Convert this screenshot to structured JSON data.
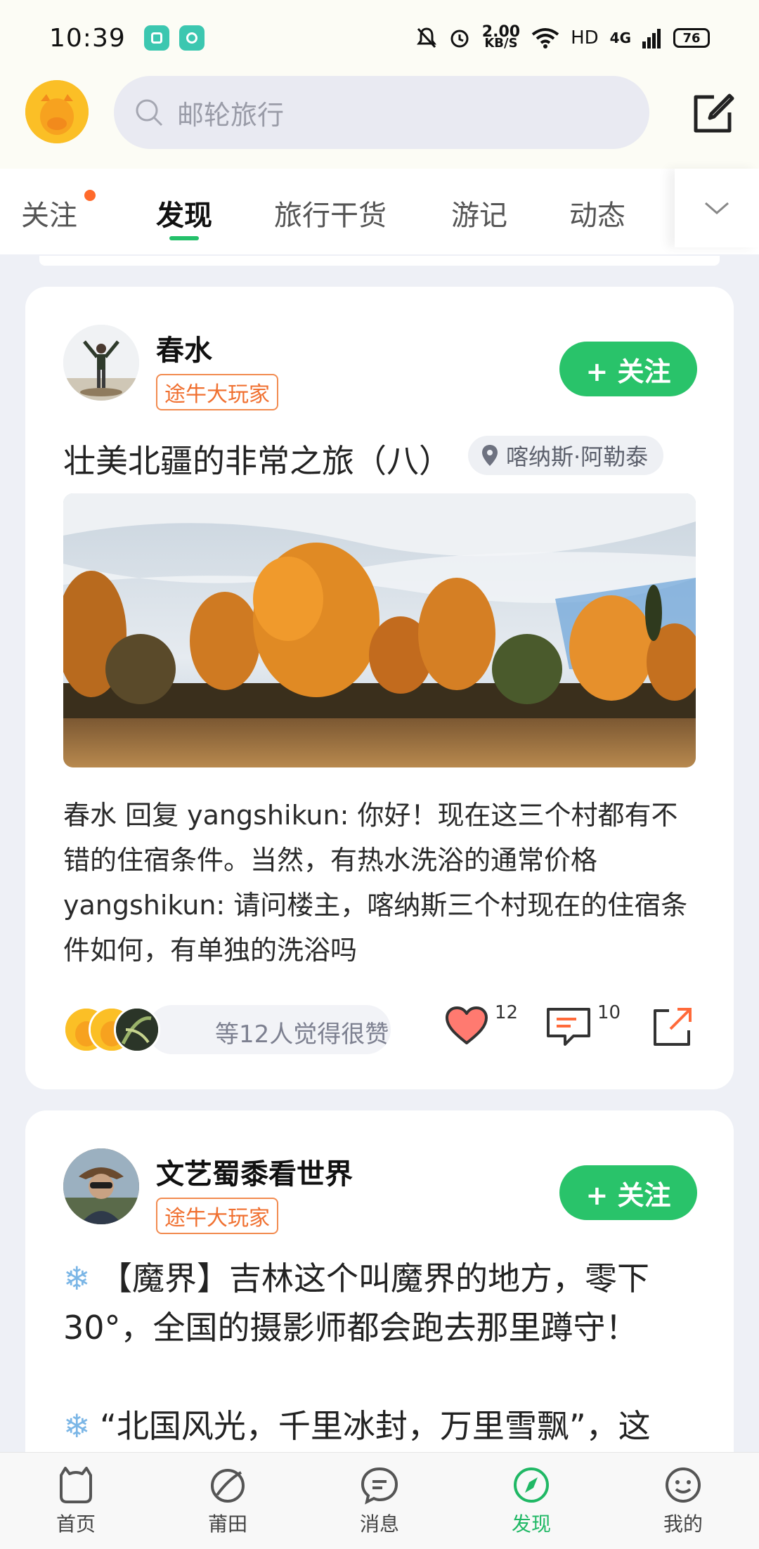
{
  "status_bar": {
    "time": "10:39",
    "speed_value": "2.00",
    "speed_unit": "KB/S",
    "hd": "HD",
    "network": "4G",
    "battery": "76"
  },
  "header": {
    "search_placeholder": "邮轮旅行"
  },
  "tabs": [
    {
      "label": "关注",
      "has_dot": true
    },
    {
      "label": "发现",
      "active": true
    },
    {
      "label": "旅行干货"
    },
    {
      "label": "游记"
    },
    {
      "label": "动态"
    }
  ],
  "posts": [
    {
      "author": "春水",
      "badge": "途牛大玩家",
      "follow_label": "+ 关注",
      "title": "壮美北疆的非常之旅（八）",
      "location": "喀纳斯·阿勒泰",
      "body": "春水 回复 yangshikun: 你好！现在这三个村都有不错的住宿条件。当然，有热水洗浴的通常价格 yangshikun: 请问楼主，喀纳斯三个村现在的住宿条件如何，有单独的洗浴吗",
      "likers_text": "等12人觉得很赞",
      "likes": "12",
      "comments": "10"
    },
    {
      "author": "文艺蜀黍看世界",
      "badge": "途牛大玩家",
      "follow_label": "+ 关注",
      "line1": "【魔界】吉林这个叫魔界的地方，零下30°，全国的摄影师都会跑去那里蹲守！",
      "line2": "“北国风光，千里冰封，万里雪飘”，这"
    }
  ],
  "bottom_nav": [
    {
      "label": "首页",
      "icon": "home-icon"
    },
    {
      "label": "莆田",
      "icon": "city-icon"
    },
    {
      "label": "消息",
      "icon": "message-icon"
    },
    {
      "label": "发现",
      "icon": "compass-icon",
      "active": true
    },
    {
      "label": "我的",
      "icon": "profile-icon"
    }
  ],
  "colors": {
    "accent_green": "#29c36a",
    "badge_orange": "#f07030",
    "tab_dot": "#ff6a2b"
  }
}
